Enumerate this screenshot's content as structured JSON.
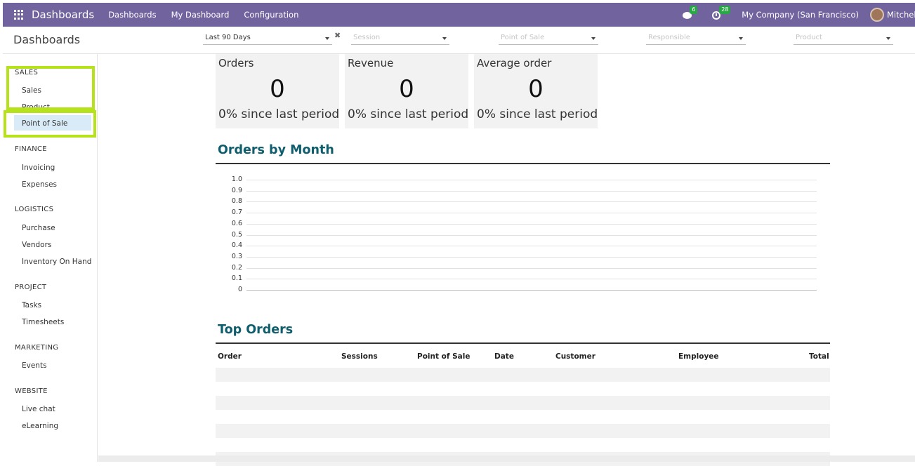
{
  "navbar": {
    "brand": "Dashboards",
    "menu": [
      "Dashboards",
      "My Dashboard",
      "Configuration"
    ],
    "messages_count": "6",
    "activities_count": "28",
    "company": "My Company (San Francisco)",
    "user": "Mitchell Admin",
    "bar_color": "#71639e"
  },
  "control": {
    "title": "Dashboards",
    "filters": {
      "period_value": "Last 90 Days",
      "session_placeholder": "Session",
      "pos_placeholder": "Point of Sale",
      "responsible_placeholder": "Responsible",
      "product_placeholder": "Product"
    }
  },
  "sidebar": {
    "sections": [
      {
        "title": "SALES",
        "items": [
          "Sales",
          "Product",
          "Point of Sale"
        ]
      },
      {
        "title": "FINANCE",
        "items": [
          "Invoicing",
          "Expenses"
        ]
      },
      {
        "title": "LOGISTICS",
        "items": [
          "Purchase",
          "Vendors",
          "Inventory On Hand"
        ]
      },
      {
        "title": "PROJECT",
        "items": [
          "Tasks",
          "Timesheets"
        ]
      },
      {
        "title": "MARKETING",
        "items": [
          "Events"
        ]
      },
      {
        "title": "WEBSITE",
        "items": [
          "Live chat",
          "eLearning"
        ]
      }
    ],
    "active_item": "Point of Sale",
    "highlight_color": "#b6e21b"
  },
  "kpis": [
    {
      "title": "Orders",
      "value": "0",
      "delta": "0% since last period"
    },
    {
      "title": "Revenue",
      "value": "0",
      "delta": "0% since last period"
    },
    {
      "title": "Average order",
      "value": "0",
      "delta": "0% since last period"
    }
  ],
  "orders_by_month": {
    "title": "Orders by Month"
  },
  "chart_data": {
    "type": "line",
    "title": "Orders by Month",
    "xlabel": "",
    "ylabel": "",
    "ylim": [
      0,
      1.0
    ],
    "yticks": [
      "1.0",
      "0.9",
      "0.8",
      "0.7",
      "0.6",
      "0.5",
      "0.4",
      "0.3",
      "0.2",
      "0.1",
      "0"
    ],
    "categories": [],
    "series": [],
    "grid": true
  },
  "top_orders": {
    "title": "Top Orders",
    "columns": [
      "Order",
      "Sessions",
      "Point of Sale",
      "Date",
      "Customer",
      "Employee",
      "Total"
    ],
    "row_count": 6
  },
  "colors": {
    "section_title": "#0f5e6e",
    "kpi_bg": "#f2f2f2",
    "active_bg": "#d9ebf6"
  }
}
